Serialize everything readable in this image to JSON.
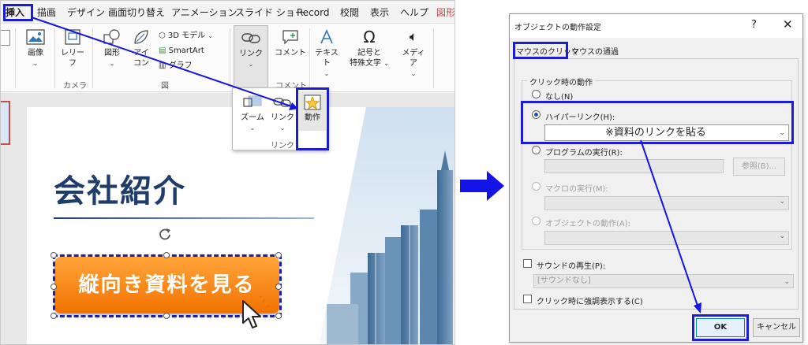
{
  "ribbon": {
    "tabs": [
      "挿入",
      "描画",
      "デザイン",
      "画面切り替え",
      "アニメーション",
      "スライド ショー",
      "Record",
      "校閲",
      "表示",
      "ヘルプ",
      "図形"
    ],
    "buttons": {
      "image": "画像",
      "layout_line1": "レリー",
      "layout_line2": "フ",
      "shape": "図形",
      "icon_line1": "アイ",
      "icon_line2": "コン",
      "model3d": "3D モデル",
      "smartart": "SmartArt",
      "graph": "グラフ",
      "link": "リンク",
      "comment": "コメント",
      "text": "テキスト",
      "symbol_line1": "記号と",
      "symbol_line2": "特殊文字",
      "media": "メディア"
    },
    "groups": {
      "camera": "カメラ",
      "figure": "図",
      "comment": "コメント"
    },
    "dropdown": {
      "zoom": "ズーム",
      "link": "リンク",
      "action": "動作",
      "group_label": "リンク"
    }
  },
  "slide": {
    "title": "会社紹介",
    "button_label": "縦向き資料を見る"
  },
  "dialog": {
    "title": "オブジェクトの動作設定",
    "help": "?",
    "close": "✕",
    "tabs": [
      "マウスのクリック",
      "マウスの通過"
    ],
    "group_title": "クリック時の動作",
    "options": {
      "none": "なし(N)",
      "hyperlink": "ハイパーリンク(H):",
      "program": "プログラムの実行(R):",
      "macro": "マクロの実行(M):",
      "object_action": "オブジェクトの動作(A):"
    },
    "hyperlink_value": "※資料のリンクを貼る",
    "browse_button": "参照(B)...",
    "play_sound": "サウンドの再生(P):",
    "sound_value": "[サウンドなし]",
    "highlight_click": "クリック時に強調表示する(C)",
    "ok": "OK",
    "cancel": "キャンセル"
  },
  "colors": {
    "annotation_blue": "#1c1cd6",
    "orange": "#f27200",
    "title_navy": "#1f3d6b",
    "arrow_blue": "#1414e6"
  }
}
